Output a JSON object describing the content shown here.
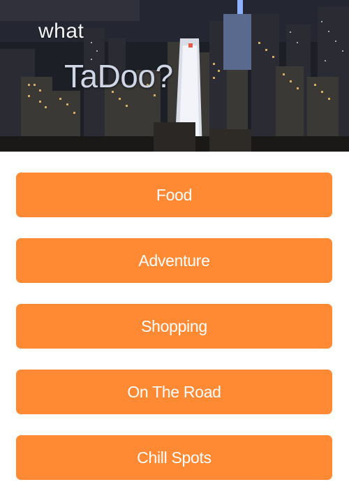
{
  "header": {
    "logo_line1": "what",
    "logo_line2": "TaDoo?"
  },
  "menu": {
    "items": [
      {
        "label": "Food"
      },
      {
        "label": "Adventure"
      },
      {
        "label": "Shopping"
      },
      {
        "label": "On The Road"
      },
      {
        "label": "Chill Spots"
      }
    ]
  },
  "colors": {
    "button_background": "#ff8a33",
    "button_text": "#ffffff",
    "page_background": "#ffffff"
  }
}
